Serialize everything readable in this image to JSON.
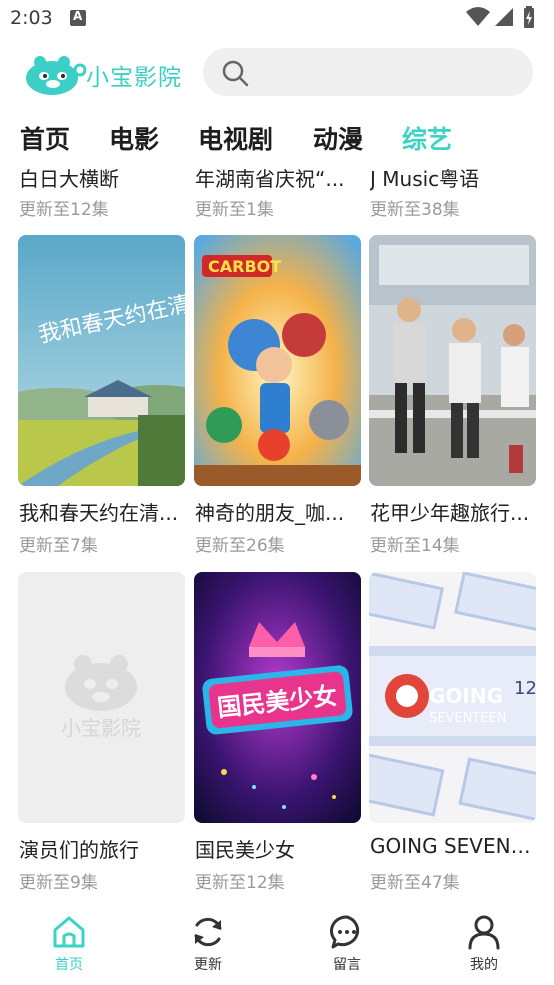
{
  "status_bar": {
    "time": "2:03"
  },
  "header": {
    "app_name": "小宝影院",
    "brand_color": "#3bcfc5"
  },
  "tabs": [
    {
      "label": "首页"
    },
    {
      "label": "电影"
    },
    {
      "label": "电视剧"
    },
    {
      "label": "动漫"
    },
    {
      "label": "综艺",
      "active": true
    }
  ],
  "grid": {
    "partial_row": [
      {
        "title": "白日大横断",
        "subtitle": "更新至12集"
      },
      {
        "title": "年湖南省庆祝“...",
        "subtitle": "更新至1集"
      },
      {
        "title": "J Music粤语",
        "subtitle": "更新至38集"
      }
    ],
    "row2": [
      {
        "title": "我和春天约在清...",
        "subtitle": "更新至7集",
        "poster_text": "我和春天约在清溪"
      },
      {
        "title": "神奇的朋友_咖...",
        "subtitle": "更新至26集",
        "poster_text": "CARBOT"
      },
      {
        "title": "花甲少年趣旅行...",
        "subtitle": "更新至14集"
      }
    ],
    "row3": [
      {
        "title": "演员们的旅行",
        "subtitle": "更新至9集",
        "placeholder_text": "小宝影院"
      },
      {
        "title": "国民美少女",
        "subtitle": "更新至12集",
        "poster_text": "国民美少女"
      },
      {
        "title": "GOING SEVENT...",
        "subtitle": "更新至47集",
        "poster_text_1": "GOING",
        "poster_text_2": "SEVENTEEN",
        "poster_text_3": "12"
      }
    ]
  },
  "bottom_nav": [
    {
      "label": "首页",
      "icon": "home-icon",
      "active": true
    },
    {
      "label": "更新",
      "icon": "refresh-icon"
    },
    {
      "label": "留言",
      "icon": "message-icon"
    },
    {
      "label": "我的",
      "icon": "user-icon"
    }
  ]
}
